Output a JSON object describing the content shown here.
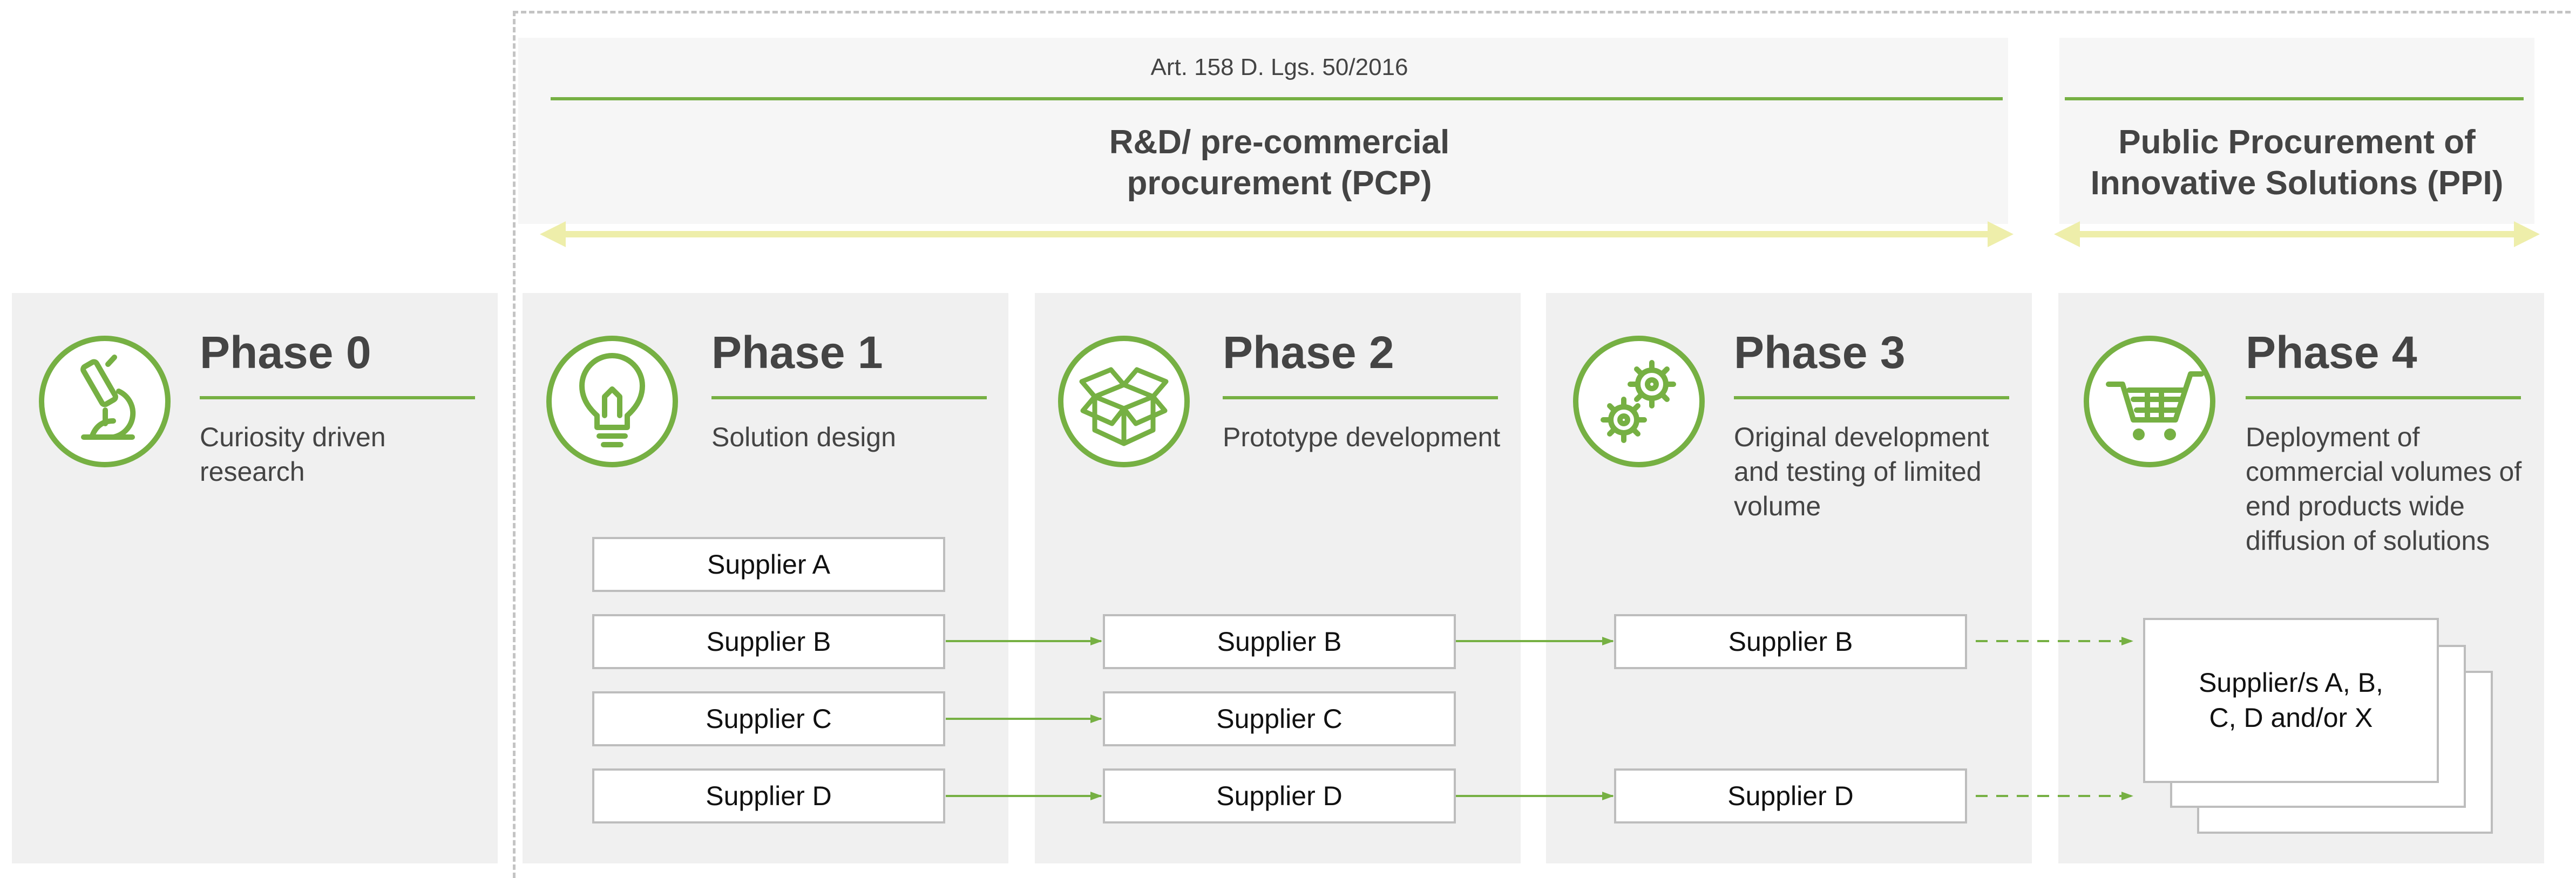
{
  "header": {
    "article": "Art. 158 D. Lgs. 50/2016",
    "pcp_title": "R&D/ pre-commercial procurement (PCP)",
    "ppi_title": "Public Procurement of Innovative Solutions (PPI)"
  },
  "phases": [
    {
      "title": "Phase 0",
      "description": "Curiosity driven research",
      "icon": "microscope-icon"
    },
    {
      "title": "Phase 1",
      "description": "Solution design",
      "icon": "lightbulb-icon"
    },
    {
      "title": "Phase 2",
      "description": "Prototype development",
      "icon": "open-box-icon"
    },
    {
      "title": "Phase 3",
      "description": "Original development and testing of limited volume",
      "icon": "gears-icon"
    },
    {
      "title": "Phase 4",
      "description": "Deployment of commercial volumes of end products wide diffusion of solutions",
      "icon": "shopping-cart-icon"
    }
  ],
  "suppliers": {
    "phase1": [
      "Supplier A",
      "Supplier B",
      "Supplier C",
      "Supplier D"
    ],
    "phase2": [
      "Supplier B",
      "Supplier C",
      "Supplier D"
    ],
    "phase3": [
      "Supplier B",
      "Supplier D"
    ],
    "phase4": "Supplier/s A, B, C, D and/or X"
  },
  "colors": {
    "accent_green": "#76b043",
    "arrow_yellow": "#eeeeaa",
    "panel_gray": "#f0f0f0",
    "text": "#444444"
  }
}
